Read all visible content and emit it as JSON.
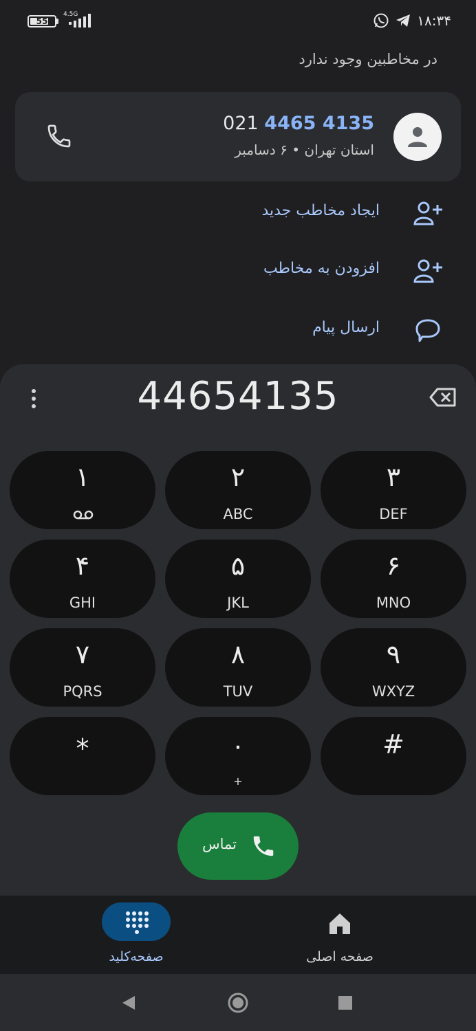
{
  "status_bar": {
    "battery_level": "55",
    "network_type": "4.5G",
    "time": "۱۸:۳۴"
  },
  "header": {
    "no_contact_text": "در مخاطبین وجود ندارد"
  },
  "result_card": {
    "number_prefix": "021",
    "number_highlight": "4465 4135",
    "subtitle": "استان تهران • ۶ دسامبر"
  },
  "actions": [
    {
      "label": "ایجاد مخاطب جدید",
      "icon": "add-person-icon"
    },
    {
      "label": "افزودن به مخاطب",
      "icon": "add-person-icon"
    },
    {
      "label": "ارسال پیام",
      "icon": "message-icon"
    }
  ],
  "dialpad": {
    "entered_number": "44654135",
    "keys": [
      {
        "num": "۱",
        "letters": ""
      },
      {
        "num": "۲",
        "letters": "ABC"
      },
      {
        "num": "۳",
        "letters": "DEF"
      },
      {
        "num": "۴",
        "letters": "GHI"
      },
      {
        "num": "۵",
        "letters": "JKL"
      },
      {
        "num": "۶",
        "letters": "MNO"
      },
      {
        "num": "۷",
        "letters": "PQRS"
      },
      {
        "num": "۸",
        "letters": "TUV"
      },
      {
        "num": "۹",
        "letters": "WXYZ"
      },
      {
        "num": "*",
        "letters": ""
      },
      {
        "num": "۰",
        "letters": "+"
      },
      {
        "num": "#",
        "letters": ""
      }
    ],
    "call_label": "تماس"
  },
  "bottom_nav": {
    "keypad_label": "صفحه‌کلید",
    "home_label": "صفحه اصلی"
  },
  "colors": {
    "accent_blue": "#8ab4f8",
    "call_green": "#1a7f3c",
    "active_pill": "#0b4f82"
  }
}
